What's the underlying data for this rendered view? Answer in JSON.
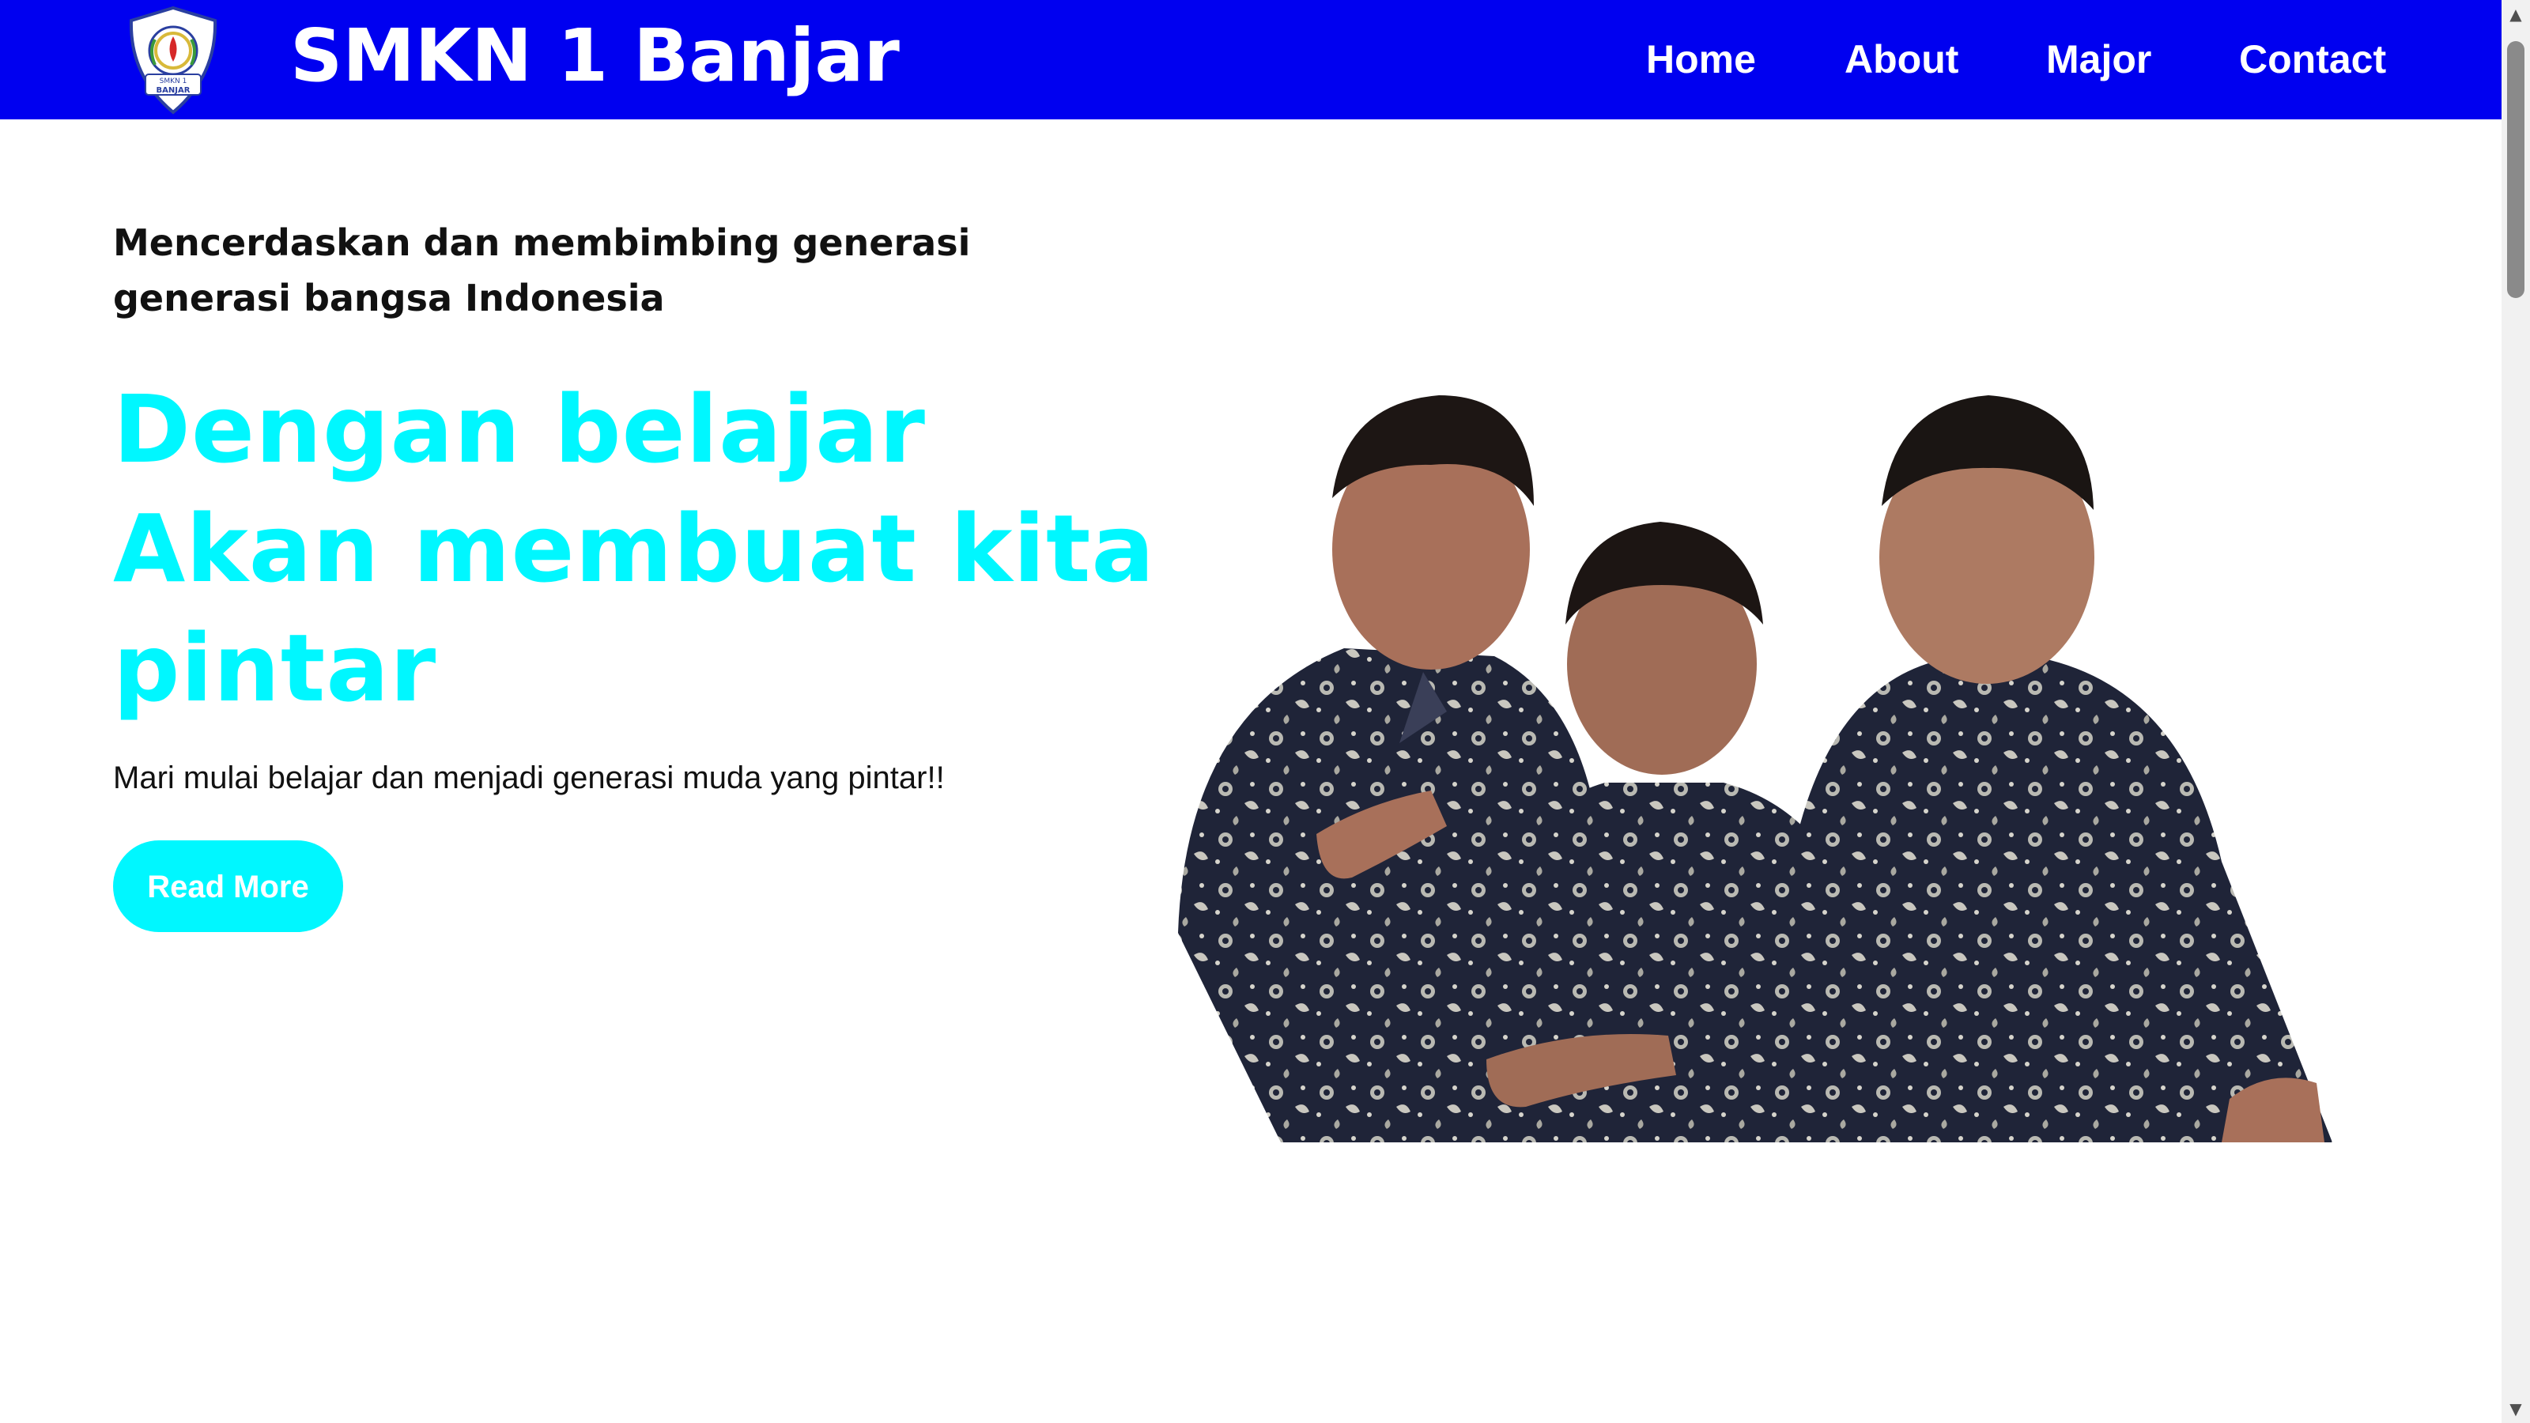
{
  "header": {
    "brand": "SMKN 1 Banjar",
    "logo_text_top": "SMKN 1",
    "logo_text_bottom": "BANJAR",
    "colors": {
      "background": "#0000f0",
      "text": "#ffffff"
    }
  },
  "nav": {
    "items": [
      {
        "label": "Home"
      },
      {
        "label": "About"
      },
      {
        "label": "Major"
      },
      {
        "label": "Contact"
      }
    ]
  },
  "hero": {
    "tagline": "Mencerdaskan dan membimbing generasi generasi bangsa Indonesia",
    "headline_lines": [
      "Dengan belajar",
      "Akan membuat kita",
      "pintar"
    ],
    "subtext": "Mari mulai belajar dan menjadi generasi muda yang pintar!!",
    "cta_label": "Read More",
    "accent_color": "#00f7ff"
  },
  "icons": {
    "logo": "school-emblem-icon",
    "scroll_up": "scroll-up-arrow-icon",
    "scroll_down": "scroll-down-arrow-icon"
  }
}
